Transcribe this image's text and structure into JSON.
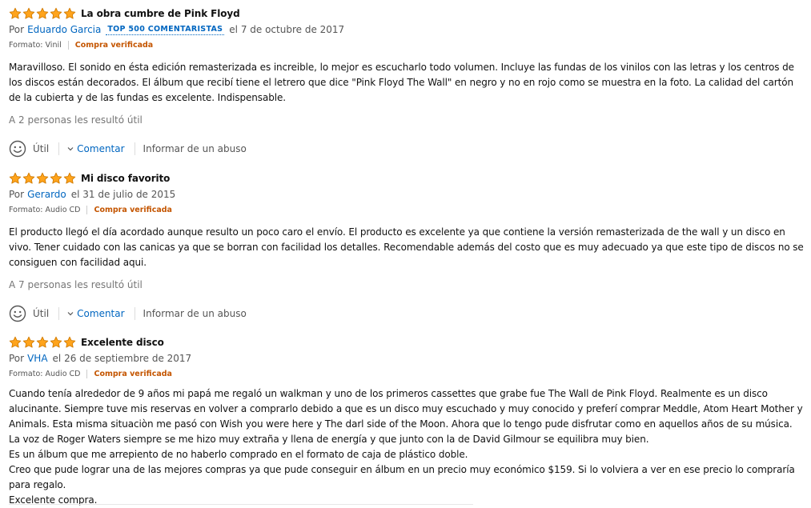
{
  "reviews": [
    {
      "rating": 5,
      "title": "La obra cumbre de Pink Floyd",
      "by_prefix": "Por",
      "author": "Eduardo Garcia",
      "badge": "TOP 500 COMENTARISTAS",
      "date": "el 7 de octubre de 2017",
      "format": "Formato: Vinil",
      "verified": "Compra verificada",
      "body": [
        "Maravilloso. El sonido en ésta edición remasterizada es increible, lo mejor es escucharlo todo volumen. Incluye las fundas de los vinilos con las letras y los centros de los discos están decorados. El álbum que recibí tiene el letrero que dice \"Pink Floyd The Wall\" en negro y no en rojo como se muestra en la foto. La calidad del cartón de la cubierta y de las fundas es excelente. Indispensable."
      ],
      "helpful": "A 2 personas les resultó útil",
      "util_label": "Útil",
      "comment_label": "Comentar",
      "abuse_label": "Informar de un abuso"
    },
    {
      "rating": 5,
      "title": "Mi disco favorito",
      "by_prefix": "Por",
      "author": "Gerardo",
      "badge": "",
      "date": "el 31 de julio de 2015",
      "format": "Formato: Audio CD",
      "verified": "Compra verificada",
      "body": [
        "El producto llegó el día acordado aunque resulto un poco caro el envío. El producto es excelente ya que contiene la versión remasterizada de the wall y un disco en vivo. Tener cuidado con las canicas ya que se borran con facilidad los detalles. Recomendable además del costo que es muy adecuado ya que este tipo de discos no se consiguen con facilidad aqui."
      ],
      "helpful": "A 7 personas les resultó útil",
      "util_label": "Útil",
      "comment_label": "Comentar",
      "abuse_label": "Informar de un abuso"
    },
    {
      "rating": 5,
      "title": "Excelente disco",
      "by_prefix": "Por",
      "author": "VHA",
      "badge": "",
      "date": "el 26 de septiembre de 2017",
      "format": "Formato: Audio CD",
      "verified": "Compra verificada",
      "body": [
        "Cuando tenía alrededor de 9 años mi papá me regaló un walkman y uno de los primeros cassettes que grabe fue The Wall de Pink Floyd. Realmente es un disco alucinante. Siempre tuve mis reservas en volver a comprarlo debido a que es un disco muy escuchado y muy conocido y preferí comprar Meddle, Atom Heart Mother y Animals. Esta misma situaciòn me pasó con Wish you were here y The darl side of the Moon. Ahora que lo tengo pude disfrutar como en aquellos años de su música. La voz de Roger Waters siempre se me hizo muy extraña y llena de energía y que junto con la de David Gilmour se equilibra muy bien.",
        "Es un álbum que me arrepiento de no haberlo comprado en el formato de caja de plástico doble.",
        "Creo que pude lograr una de las mejores compras ya que pude conseguir en álbum en un precio muy económico $159. Si lo volviera a ver en ese precio lo compraría para regalo.",
        "Excelente compra."
      ]
    }
  ],
  "colors": {
    "star": "#ffa41c",
    "link": "#0066c0",
    "verified": "#c45500",
    "muted": "#555555"
  },
  "icons": {
    "star": "star-icon",
    "smiley": "smiley-icon",
    "chevron": "chevron-down-icon"
  }
}
